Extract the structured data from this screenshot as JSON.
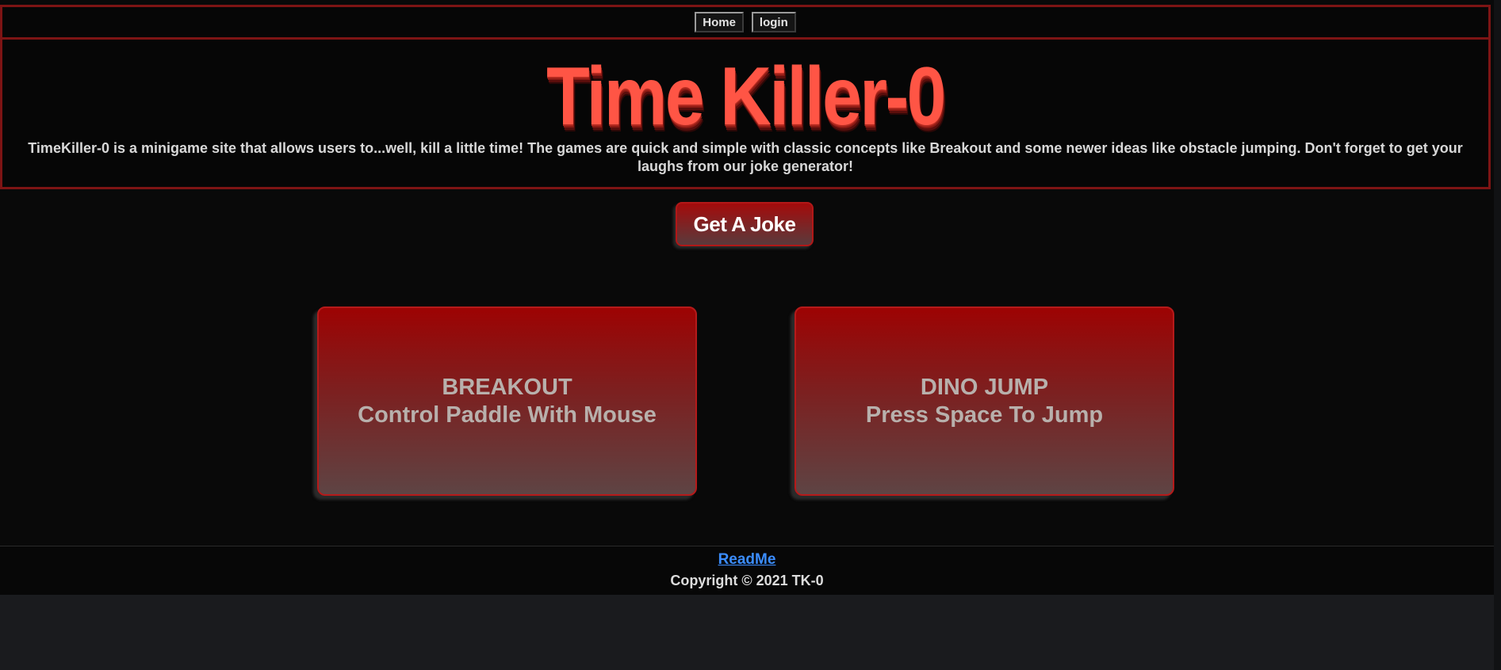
{
  "nav": {
    "home_label": "Home",
    "login_label": "login"
  },
  "header": {
    "title": "Time Killer-0",
    "description": "TimeKiller-0 is a minigame site that allows users to...well, kill a little time! The games are quick and simple with classic concepts like Breakout and some newer ideas like obstacle jumping. Don't forget to get your laughs from our joke generator!"
  },
  "joke_button_label": "Get A Joke",
  "games": [
    {
      "title": "BREAKOUT",
      "instructions": "Control Paddle With Mouse"
    },
    {
      "title": "DINO JUMP",
      "instructions": "Press Space To Jump"
    }
  ],
  "footer": {
    "readme_label": "ReadMe",
    "copyright": "Copyright © 2021 TK-0"
  },
  "colors": {
    "accent": "#ff5545",
    "border": "#7d1414",
    "card_top": "#9d0303",
    "link": "#3b8dff",
    "background": "#090909"
  }
}
